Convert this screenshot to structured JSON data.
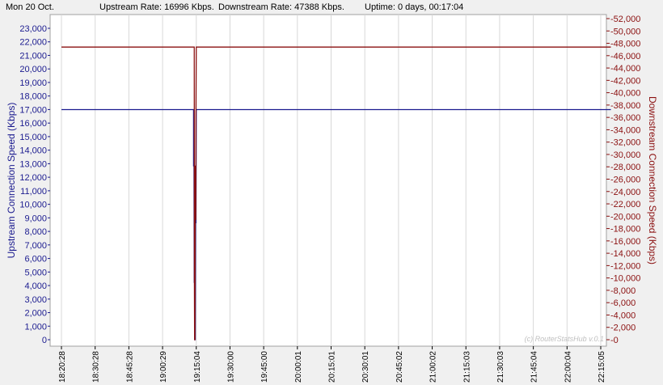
{
  "status_bar": {
    "date": "Mon 20 Oct.",
    "upstream": "Upstream Rate: 16996 Kbps.",
    "downstream": "Downstream Rate: 47388 Kbps.",
    "uptime": "Uptime: 0 days, 00:17:04"
  },
  "colors": {
    "upstream": "#1b1b8f",
    "downstream": "#8b1010",
    "background": "#f0f0f0",
    "plot_area": "#ffffff",
    "grid": "#d8d8d8"
  },
  "chart_data": {
    "type": "line",
    "title": "",
    "watermark": "(c) RouterStatsHub v.0.1",
    "x_tick_labels": [
      "18:20:28",
      "18:30:28",
      "18:45:28",
      "19:00:29",
      "19:15:04",
      "19:30:00",
      "19:45:00",
      "20:00:01",
      "20:15:01",
      "20:30:01",
      "20:45:02",
      "21:00:02",
      "21:15:03",
      "21:30:03",
      "21:45:04",
      "22:00:04",
      "22:15:05"
    ],
    "y_left": {
      "label": "Upstream Connection Speed (Kbps)",
      "range": [
        0,
        23000
      ],
      "ticks": [
        "0",
        "1,000",
        "2,000",
        "3,000",
        "4,000",
        "5,000",
        "6,000",
        "7,000",
        "8,000",
        "9,000",
        "10,000",
        "11,000",
        "12,000",
        "13,000",
        "14,000",
        "15,000",
        "16,000",
        "17,000",
        "18,000",
        "19,000",
        "20,000",
        "21,000",
        "22,000",
        "23,000"
      ]
    },
    "y_right": {
      "label": "Downstream Connection Speed (Kbps)",
      "range": [
        0,
        52000
      ],
      "ticks": [
        "0",
        "2,000",
        "4,000",
        "6,000",
        "8,000",
        "10,000",
        "12,000",
        "14,000",
        "16,000",
        "18,000",
        "20,000",
        "22,000",
        "24,000",
        "26,000",
        "28,000",
        "30,000",
        "32,000",
        "34,000",
        "36,000",
        "38,000",
        "40,000",
        "42,000",
        "44,000",
        "46,000",
        "48,000",
        "50,000",
        "52,000"
      ]
    },
    "series": [
      {
        "name": "Upstream",
        "axis": "left",
        "points": [
          [
            0,
            16996
          ],
          [
            3.92,
            16996
          ],
          [
            3.92,
            12800
          ],
          [
            3.93,
            16100
          ],
          [
            3.94,
            4200
          ],
          [
            3.945,
            12800
          ],
          [
            3.95,
            0
          ],
          [
            3.97,
            0
          ],
          [
            3.98,
            10800
          ],
          [
            3.99,
            8600
          ],
          [
            4.0,
            16996
          ],
          [
            16.3,
            16996
          ]
        ]
      },
      {
        "name": "Downstream",
        "axis": "right",
        "points": [
          [
            0,
            47388
          ],
          [
            3.93,
            47388
          ],
          [
            3.94,
            47388
          ],
          [
            3.945,
            9500
          ],
          [
            3.95,
            0
          ],
          [
            3.96,
            0
          ],
          [
            3.97,
            28200
          ],
          [
            3.985,
            19400
          ],
          [
            3.99,
            36000
          ],
          [
            4.0,
            47388
          ],
          [
            16.3,
            47388
          ]
        ]
      }
    ]
  }
}
